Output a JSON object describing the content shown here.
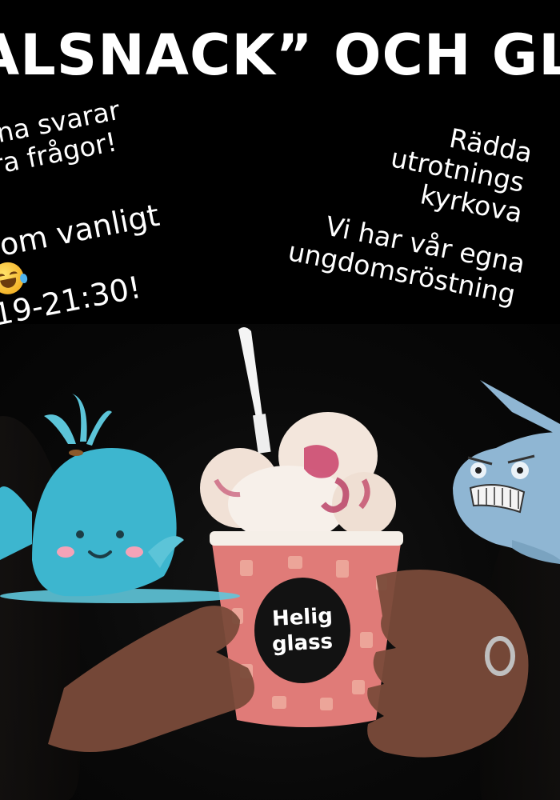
{
  "headline": "ALSNACK” OCH GLA",
  "left_block_1": [
    "erna svarar",
    "ara frågor!"
  ],
  "left_block_2": [
    "Som vanligt",
    "19-21:30!"
  ],
  "right_block_1": [
    "Rädda",
    "utrotnings",
    "kyrkova"
  ],
  "right_block_2": [
    "Vi har vår egna",
    "ungdomsröstning"
  ],
  "cup_label": [
    "Helig",
    "glass"
  ],
  "icons": {
    "emoji": "face-with-tears-of-joy-icon",
    "whale": "cartoon-whale",
    "narwhal": "meme-face-narwhal"
  },
  "colors": {
    "background": "#000000",
    "text": "#ffffff",
    "whale": "#3db6cf",
    "cup": "#e07b78"
  }
}
